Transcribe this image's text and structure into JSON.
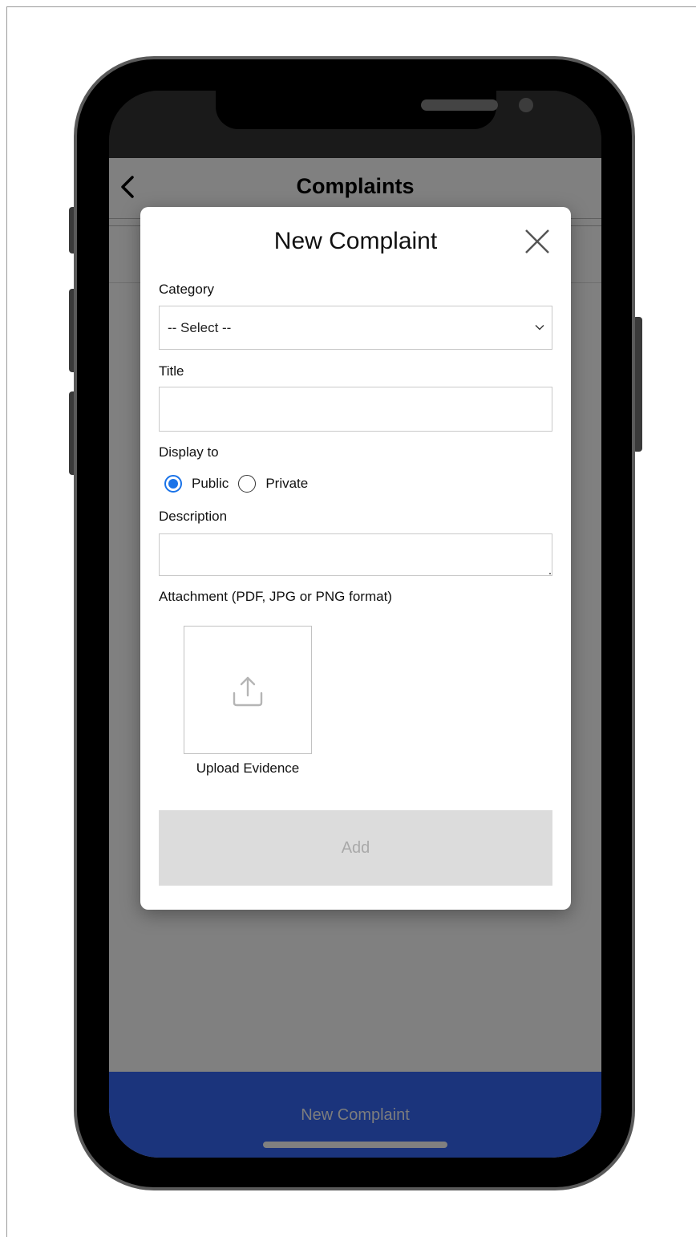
{
  "app": {
    "title": "Complaints"
  },
  "modal": {
    "title": "New Complaint",
    "category": {
      "label": "Category",
      "selected": "-- Select --"
    },
    "title_field": {
      "label": "Title",
      "value": ""
    },
    "display_to": {
      "label": "Display to",
      "options": [
        {
          "label": "Public",
          "checked": true
        },
        {
          "label": "Private",
          "checked": false
        }
      ]
    },
    "description": {
      "label": "Description",
      "value": ""
    },
    "attachment": {
      "label": "Attachment (PDF, JPG or PNG format)",
      "upload_label": "Upload Evidence"
    },
    "add_label": "Add"
  },
  "bottom_bar": {
    "label": "New Complaint"
  },
  "colors": {
    "accent_blue": "#1a73e8",
    "bottom_bar": "#1b347c",
    "overlay_gray": "#808080",
    "disabled_button": "#dcdcdc"
  }
}
